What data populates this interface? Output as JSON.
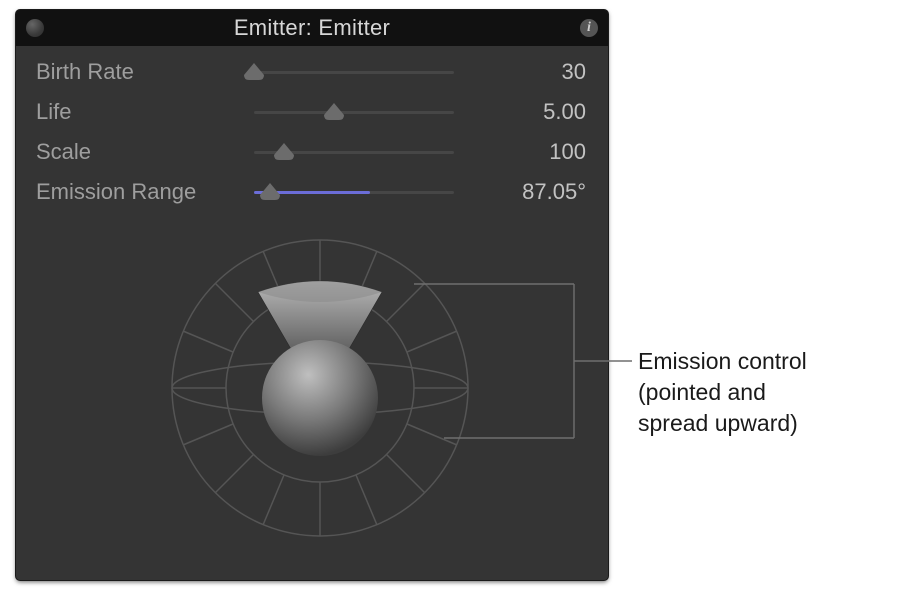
{
  "colors": {
    "panel_bg": "#343434",
    "header_bg": "#111111",
    "track": "#464646",
    "fill": "#6b6dd8",
    "label": "#9e9e9e",
    "value": "#c2c2c2",
    "title": "#d7d7d7"
  },
  "header": {
    "title": "Emitter: Emitter"
  },
  "params": {
    "birth_rate": {
      "label": "Birth Rate",
      "value": "30",
      "fill_pct": 0,
      "thumb_pct": 0
    },
    "life": {
      "label": "Life",
      "value": "5.00",
      "fill_pct": 0,
      "thumb_pct": 40
    },
    "scale": {
      "label": "Scale",
      "value": "100",
      "fill_pct": 0,
      "thumb_pct": 15
    },
    "emission": {
      "label": "Emission Range",
      "value": "87.05°",
      "fill_pct": 58,
      "thumb_pct": 8
    }
  },
  "callout": {
    "line1": "Emission control",
    "line2": "(pointed and",
    "line3": "spread upward)"
  },
  "chart_data": {
    "type": "radial-direction-control",
    "note": "Emission angle direction/spread widget",
    "direction_deg_from_up": 0,
    "spread_deg": 87.05
  }
}
